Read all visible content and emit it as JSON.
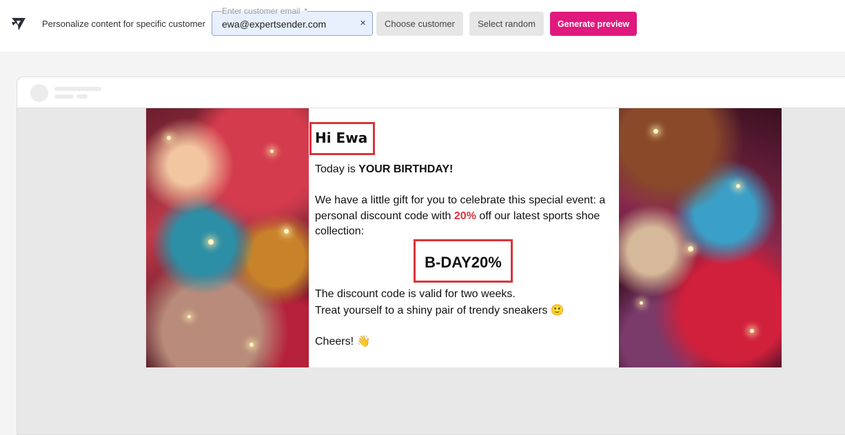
{
  "topbar": {
    "logo_icon": "expertsender-logo-icon",
    "tagline": "Personalize content for specific customer",
    "email_field": {
      "label": "Enter customer email",
      "required_mark": "*",
      "value": "ewa@expertsender.com",
      "clear_icon": "×"
    },
    "buttons": {
      "choose": "Choose customer",
      "random": "Select random",
      "generate": "Generate preview"
    }
  },
  "email": {
    "greeting": "Hi Ewa",
    "line1_prefix": "Today is ",
    "line1_bold": "YOUR BIRTHDAY!",
    "line2_prefix": "We have a little gift for you to celebrate this special event: a personal discount code with ",
    "line2_percent": "20%",
    "line2_suffix": " off our latest sports shoe collection:",
    "discount_code": "B-DAY20%",
    "line3": "The discount code is valid for two weeks.",
    "line4_text": "Treat yourself to a shiny pair of trendy sneakers ",
    "line4_emoji": "🙂",
    "closing": "Cheers!",
    "closing_emoji": "👋"
  },
  "colors": {
    "accent": "#e0197e",
    "highlight": "#d9343c"
  }
}
